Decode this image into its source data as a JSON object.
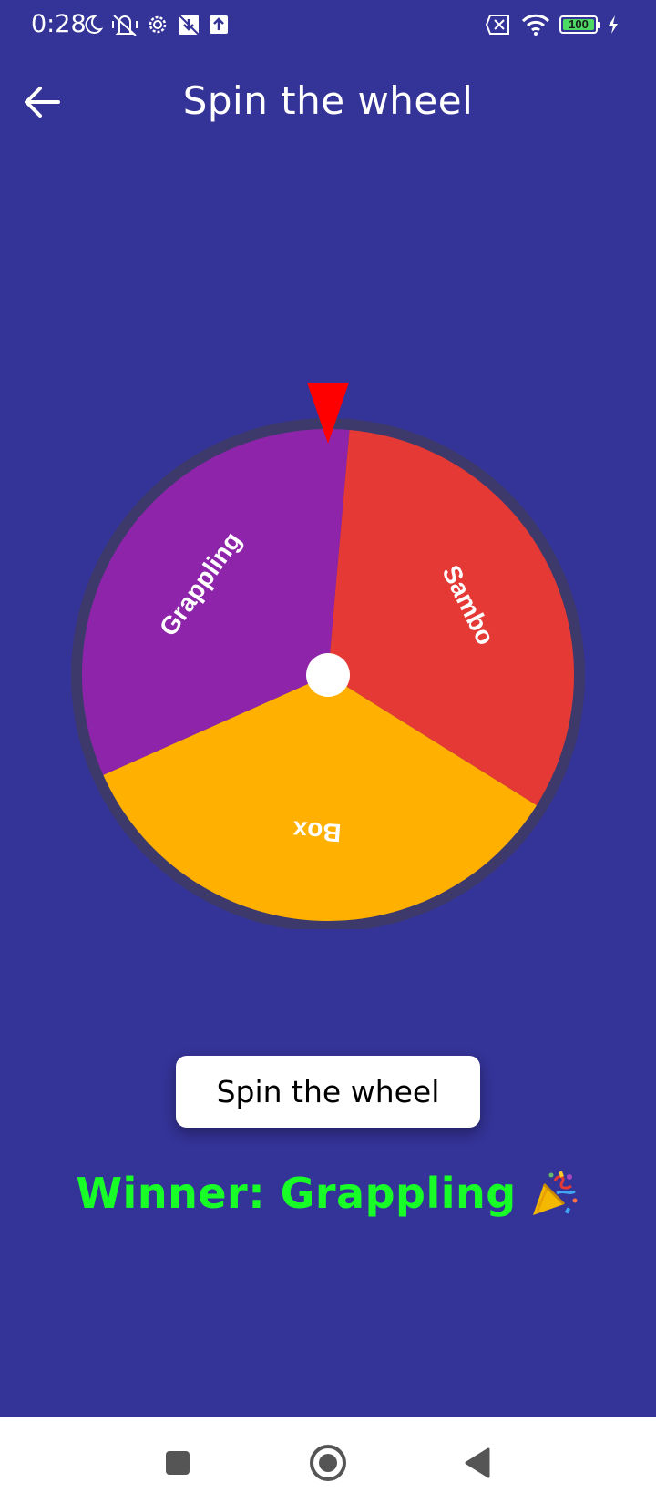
{
  "status_bar": {
    "time": "0:28",
    "battery_level": "100",
    "left_icons": [
      "moon-icon",
      "muted-vibrate-icon",
      "settings-gear-icon",
      "download-icon",
      "upload-icon"
    ],
    "right_icons": [
      "sim-off-icon",
      "wifi-icon",
      "battery-icon",
      "charging-bolt-icon"
    ]
  },
  "app_bar": {
    "title": "Spin the wheel",
    "back_icon": "arrow-back-icon"
  },
  "wheel": {
    "segments": [
      {
        "label": "Sambo",
        "color": "#E53935"
      },
      {
        "label": "Box",
        "color": "#FFB000"
      },
      {
        "label": "Grappling",
        "color": "#8E24AA"
      }
    ],
    "rim_color": "#3D3A6B",
    "hub_color": "#FFFFFF",
    "pointer_color": "#FF0000"
  },
  "actions": {
    "spin_label": "Spin the wheel"
  },
  "result": {
    "winner_text": "Winner: Grappling",
    "emoji_icon": "party-popper-icon"
  },
  "nav_bar": {
    "icons": [
      "recents-square-icon",
      "home-circle-icon",
      "back-triangle-icon"
    ]
  },
  "colors": {
    "background": "#343397",
    "winner_text": "#17FF26",
    "button_bg": "#FFFFFF"
  }
}
